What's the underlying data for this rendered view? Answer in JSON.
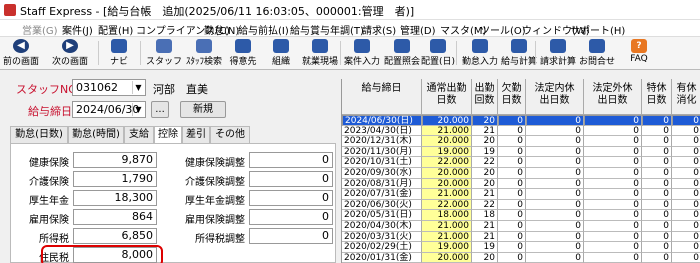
{
  "window": {
    "title": "Staff Express - [給与台帳　追加(2025/06/11 16:03:05、000001:管理　者)]"
  },
  "menu": [
    "営業(G)",
    "案件(J)",
    "配置(H)",
    "コンプライアンス(C)",
    "勤怠(N)",
    "給与前払(I)",
    "給与賞与年調(T)",
    "請求(S)",
    "管理(D)",
    "マスタ(M)",
    "ツール(O)",
    "ウィンドウ(W)",
    "サポート(H)"
  ],
  "toolbar": [
    "前の画面",
    "次の画面",
    "ナビ",
    "スタッフ",
    "ｽﾀｯﾌ検索",
    "得意先",
    "組織",
    "就業現場",
    "案件入力",
    "配置照会",
    "配置(日)",
    "勤怠入力",
    "給与計算",
    "請求計算",
    "お問合せ",
    "FAQ"
  ],
  "form": {
    "staff_no_label": "スタッフNO",
    "staff_no": "031062",
    "staff_name": "河部　直美",
    "pay_date_label": "給与締日",
    "pay_date": "2024/06/30",
    "ellipsis": "...",
    "new_button": "新規"
  },
  "tabs": [
    "勤怠(日数)",
    "勤怠(時間)",
    "支給",
    "控除",
    "差引",
    "その他"
  ],
  "deductions_left": [
    {
      "label": "健康保険",
      "value": "9,870"
    },
    {
      "label": "介護保険",
      "value": "1,790"
    },
    {
      "label": "厚生年金",
      "value": "18,300"
    },
    {
      "label": "雇用保険",
      "value": "864"
    },
    {
      "label": "所得税",
      "value": "6,850"
    },
    {
      "label": "住民税",
      "value": "8,000"
    }
  ],
  "deductions_right": [
    {
      "label": "健康保険調整",
      "value": "0"
    },
    {
      "label": "介護保険調整",
      "value": "0"
    },
    {
      "label": "厚生年金調整",
      "value": "0"
    },
    {
      "label": "雇用保険調整",
      "value": "0"
    },
    {
      "label": "所得税調整",
      "value": "0"
    }
  ],
  "grid": {
    "headers": [
      "給与締日",
      "通常出勤\n日数",
      "出勤\n回数",
      "欠勤\n日数",
      "法定内休\n出日数",
      "法定外休\n出日数",
      "特休\n日数",
      "有休\n消化"
    ],
    "rows": [
      [
        "2024/06/30(日)",
        "20.000",
        "20",
        "0",
        "0",
        "0",
        "0",
        "0"
      ],
      [
        "2023/04/30(日)",
        "21.000",
        "21",
        "0",
        "0",
        "0",
        "0",
        "0"
      ],
      [
        "2020/12/31(木)",
        "20.000",
        "20",
        "0",
        "0",
        "0",
        "0",
        "0"
      ],
      [
        "2020/11/30(月)",
        "19.000",
        "19",
        "0",
        "0",
        "0",
        "0",
        "0"
      ],
      [
        "2020/10/31(土)",
        "22.000",
        "22",
        "0",
        "0",
        "0",
        "0",
        "0"
      ],
      [
        "2020/09/30(水)",
        "20.000",
        "20",
        "0",
        "0",
        "0",
        "0",
        "0"
      ],
      [
        "2020/08/31(月)",
        "20.000",
        "20",
        "0",
        "0",
        "0",
        "0",
        "0"
      ],
      [
        "2020/07/31(金)",
        "21.000",
        "21",
        "0",
        "0",
        "0",
        "0",
        "0"
      ],
      [
        "2020/06/30(火)",
        "22.000",
        "22",
        "0",
        "0",
        "0",
        "0",
        "0"
      ],
      [
        "2020/05/31(日)",
        "18.000",
        "18",
        "0",
        "0",
        "0",
        "0",
        "0"
      ],
      [
        "2020/04/30(木)",
        "21.000",
        "21",
        "0",
        "0",
        "0",
        "0",
        "0"
      ],
      [
        "2020/03/31(火)",
        "21.000",
        "21",
        "0",
        "0",
        "0",
        "0",
        "0"
      ],
      [
        "2020/02/29(土)",
        "19.000",
        "19",
        "0",
        "0",
        "0",
        "0",
        "0"
      ],
      [
        "2020/01/31(金)",
        "20.000",
        "20",
        "0",
        "0",
        "0",
        "0",
        "0"
      ]
    ]
  }
}
